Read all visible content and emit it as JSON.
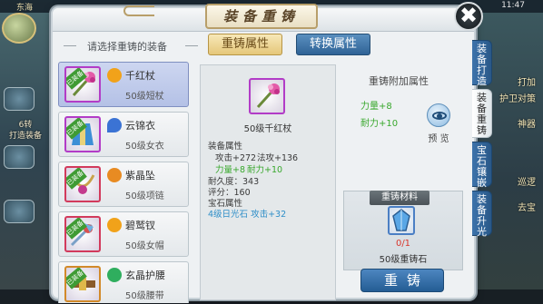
{
  "background": {
    "top_name": "东海",
    "top_time": "11:47",
    "left_labels": [
      "6转",
      "打造装备"
    ],
    "right_labels": [
      "打加",
      "护卫对策",
      "神器",
      "巡逻",
      "去宝"
    ]
  },
  "dialog": {
    "title": "装备重铸",
    "close_symbol": "✖"
  },
  "left_list": {
    "hint": "请选择重铸的装备",
    "equip_tag": "已装备",
    "items": [
      {
        "name": "千红杖",
        "desc": "50级短杖",
        "icon": "staff-icon",
        "type_color": "#f1a21a"
      },
      {
        "name": "云锦衣",
        "desc": "50级女衣",
        "icon": "robe-icon",
        "type_color": "#3b73d4"
      },
      {
        "name": "紫晶坠",
        "desc": "50级项链",
        "icon": "necklace-icon",
        "type_color": "#e88b22"
      },
      {
        "name": "碧鹫钗",
        "desc": "50级女帽",
        "icon": "hairpin-icon",
        "type_color": "#f1a21a"
      },
      {
        "name": "玄晶护腰",
        "desc": "50级腰带",
        "icon": "belt-icon",
        "type_color": "#2fae5e"
      }
    ]
  },
  "tabs": {
    "recast": "重铸属性",
    "convert": "转换属性"
  },
  "detail": {
    "name": "50级千红杖",
    "attr_title": "装备属性",
    "attack": "攻击+272",
    "magic_attack": "法攻+136",
    "power": "力量+8",
    "endurance": "耐力+10",
    "durability": "耐久度：343",
    "score": "评分：160",
    "gem_title": "宝石属性",
    "gem_line": "4级日光石  攻击+32"
  },
  "extra": {
    "title": "重铸附加属性",
    "power": "力量+8",
    "endurance": "耐力+10",
    "preview": "预 览"
  },
  "material": {
    "title": "重铸材料",
    "count": "0/1",
    "name": "50级重铸石"
  },
  "action": {
    "recast_button": "重铸"
  },
  "side_tabs": [
    {
      "label": "装备打造",
      "active": false
    },
    {
      "label": "装备重铸",
      "active": true
    },
    {
      "label": "宝石镶嵌",
      "active": false
    },
    {
      "label": "装备升光",
      "active": false
    }
  ],
  "colors": {
    "accent_gold": "#e5c77a",
    "accent_blue": "#2f6396",
    "stat_green": "#38a82c",
    "gem_blue": "#2e8ec8",
    "count_red": "#d9362c",
    "equip_border": "#b23cc7"
  }
}
